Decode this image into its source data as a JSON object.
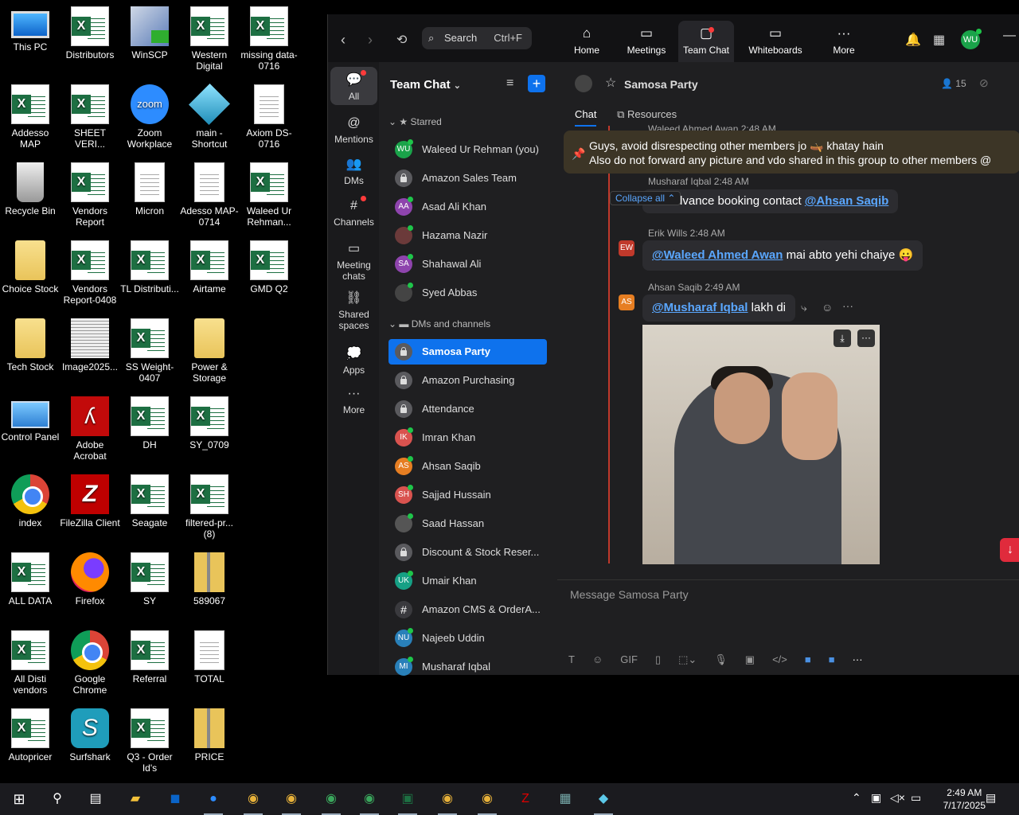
{
  "desktop": {
    "icons": [
      {
        "label": "This PC"
      },
      {
        "label": "Distributors"
      },
      {
        "label": "WinSCP"
      },
      {
        "label": "Western Digital"
      },
      {
        "label": "missing data-0716"
      },
      {
        "label": "Addesso MAP"
      },
      {
        "label": "SHEET VERI..."
      },
      {
        "label": "Zoom Workplace"
      },
      {
        "label": "main - Shortcut"
      },
      {
        "label": "Axiom DS-0716"
      },
      {
        "label": "Recycle Bin"
      },
      {
        "label": "Vendors Report"
      },
      {
        "label": "Micron"
      },
      {
        "label": "Adesso MAP-0714"
      },
      {
        "label": "Waleed Ur Rehman..."
      },
      {
        "label": "Choice Stock"
      },
      {
        "label": "Vendors Report-0408"
      },
      {
        "label": "TL Distributi..."
      },
      {
        "label": "Airtame"
      },
      {
        "label": "GMD Q2"
      },
      {
        "label": "Tech Stock"
      },
      {
        "label": "Image2025..."
      },
      {
        "label": "SS Weight-0407"
      },
      {
        "label": "Power & Storage"
      },
      {
        "label": "Control Panel"
      },
      {
        "label": "Adobe Acrobat"
      },
      {
        "label": "DH"
      },
      {
        "label": "SY_0709"
      },
      {
        "label": "index"
      },
      {
        "label": "FileZilla Client"
      },
      {
        "label": "Seagate"
      },
      {
        "label": "filtered-pr... (8)"
      },
      {
        "label": "ALL DATA"
      },
      {
        "label": "Firefox"
      },
      {
        "label": "SY"
      },
      {
        "label": "589067"
      },
      {
        "label": "All Disti vendors"
      },
      {
        "label": "Google Chrome"
      },
      {
        "label": "Referral"
      },
      {
        "label": "TOTAL"
      },
      {
        "label": "Autopricer"
      },
      {
        "label": "Surfshark"
      },
      {
        "label": "Q3 - Order Id's"
      },
      {
        "label": "PRICE"
      }
    ]
  },
  "zoom": {
    "search": {
      "label": "Search",
      "shortcut": "Ctrl+F"
    },
    "tabs": [
      {
        "label": "Home"
      },
      {
        "label": "Meetings"
      },
      {
        "label": "Team Chat"
      },
      {
        "label": "Whiteboards"
      },
      {
        "label": "More"
      }
    ],
    "user_initials": "WU",
    "rail": [
      {
        "label": "All"
      },
      {
        "label": "Mentions"
      },
      {
        "label": "DMs"
      },
      {
        "label": "Channels"
      },
      {
        "label": "Meeting chats"
      },
      {
        "label": "Shared spaces"
      },
      {
        "label": "Apps"
      },
      {
        "label": "More"
      }
    ],
    "list_title": "Team Chat",
    "starred_label": "Starred",
    "starred": [
      {
        "name": "Waleed Ur Rehman (you)",
        "initials": "WU",
        "color": "#1aa34a"
      },
      {
        "name": "Amazon Sales Team",
        "initials": "",
        "color": ""
      },
      {
        "name": "Asad Ali Khan",
        "initials": "AA",
        "color": "#8e44ad"
      },
      {
        "name": "Hazama Nazir",
        "initials": "",
        "color": "#6b3a3a"
      },
      {
        "name": "Shahawal Ali",
        "initials": "SA",
        "color": "#8e44ad"
      },
      {
        "name": "Syed Abbas",
        "initials": "",
        "color": "#444"
      }
    ],
    "dm_label": "DMs and channels",
    "channels": [
      {
        "name": "Samosa Party",
        "initials": "",
        "color": ""
      },
      {
        "name": "Amazon Purchasing",
        "initials": "",
        "color": ""
      },
      {
        "name": "Attendance",
        "initials": "",
        "color": ""
      },
      {
        "name": "Imran Khan",
        "initials": "IK",
        "color": "#d9534f"
      },
      {
        "name": "Ahsan Saqib",
        "initials": "AS",
        "color": "#e67e22"
      },
      {
        "name": "Sajjad Hussain",
        "initials": "SH",
        "color": "#d9534f"
      },
      {
        "name": "Saad Hassan",
        "initials": "",
        "color": "#555"
      },
      {
        "name": "Discount & Stock Reser...",
        "initials": "",
        "color": ""
      },
      {
        "name": "Umair Khan",
        "initials": "UK",
        "color": "#16a085"
      },
      {
        "name": "Amazon CMS & OrderA...",
        "initials": "#",
        "color": ""
      },
      {
        "name": "Najeeb Uddin",
        "initials": "NU",
        "color": "#2980b9"
      },
      {
        "name": "Musharaf Iqbal",
        "initials": "MI",
        "color": "#2980b9"
      }
    ],
    "chat": {
      "title": "Samosa Party",
      "member_count": "15",
      "tab_chat": "Chat",
      "tab_resources": "Resources",
      "pinned_line1": "Guys, avoid disrespecting other members jo 🛶 khatay hain",
      "pinned_line2": "Also do not forward any picture and vdo shared in this group to other members @",
      "m0_header": "Waleed Ahmed Awan 2:48 AM",
      "m1_name": "Musharaf Iqbal",
      "m1_time": "2:48 AM",
      "m1_text": "for advance booking contact",
      "m1_mention": "@Ahsan Saqib",
      "collapse": "Collapse all",
      "m2_name": "Erik Wills",
      "m2_time": "2:48 AM",
      "m2_initials": "EW",
      "m2_mention": "@Waleed Ahmed Awan",
      "m2_text": "mai abto yehi chaiye 😛",
      "m3_name": "Ahsan Saqib",
      "m3_time": "2:49 AM",
      "m3_initials": "AS",
      "m3_mention": "@Musharaf Iqbal",
      "m3_text": "lakh di",
      "composer_placeholder": "Message Samosa Party"
    }
  },
  "taskbar": {
    "time": "2:49 AM",
    "date": "7/17/2025"
  }
}
